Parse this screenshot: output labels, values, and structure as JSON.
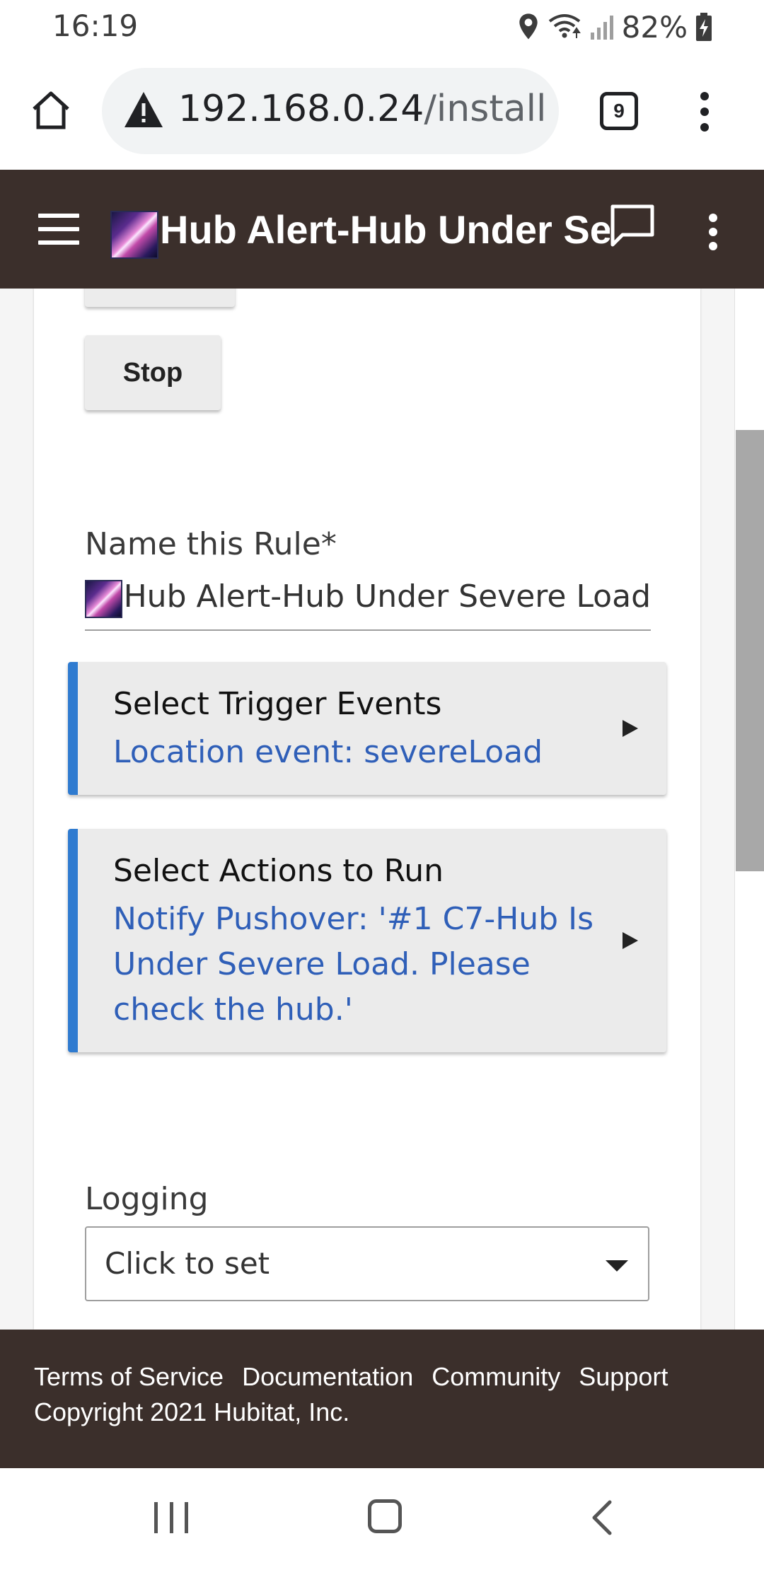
{
  "status_bar": {
    "time": "16:19",
    "battery": "82%",
    "icons": [
      "location-icon",
      "wifi-icon",
      "signal-icon",
      "battery-charging-icon"
    ]
  },
  "browser": {
    "url_host": "192.168.0.24",
    "url_path": "/installed",
    "tab_count": "9",
    "icons": [
      "home-icon",
      "not-secure-warning-icon",
      "tabs-icon",
      "more-vert-icon"
    ]
  },
  "header": {
    "title": "Hub Alert-Hub Under Severe Load",
    "icons": [
      "menu-icon",
      "galaxy-app-icon",
      "chat-icon",
      "more-vert-icon"
    ]
  },
  "content": {
    "stop_button_label": "Stop",
    "name_label": "Name this Rule*",
    "name_value": "Hub Alert-Hub Under Severe Load",
    "trigger": {
      "title": "Select Trigger Events",
      "subtitle": "Location event: severeLoad"
    },
    "actions": {
      "title": "Select Actions to Run",
      "subtitle": "Notify Pushover: '#1 C7-Hub Is Under Severe Load. Please check the hub.'"
    },
    "logging": {
      "label": "Logging",
      "value": "Click to set"
    }
  },
  "footer": {
    "links": [
      "Terms of Service",
      "Documentation",
      "Community",
      "Support"
    ],
    "copyright": "Copyright 2021 Hubitat, Inc."
  },
  "colors": {
    "header_bg": "#3b2f2b",
    "accent_blue": "#2f7bd0",
    "link_blue": "#2f5fb8",
    "button_bg": "#ececec"
  }
}
